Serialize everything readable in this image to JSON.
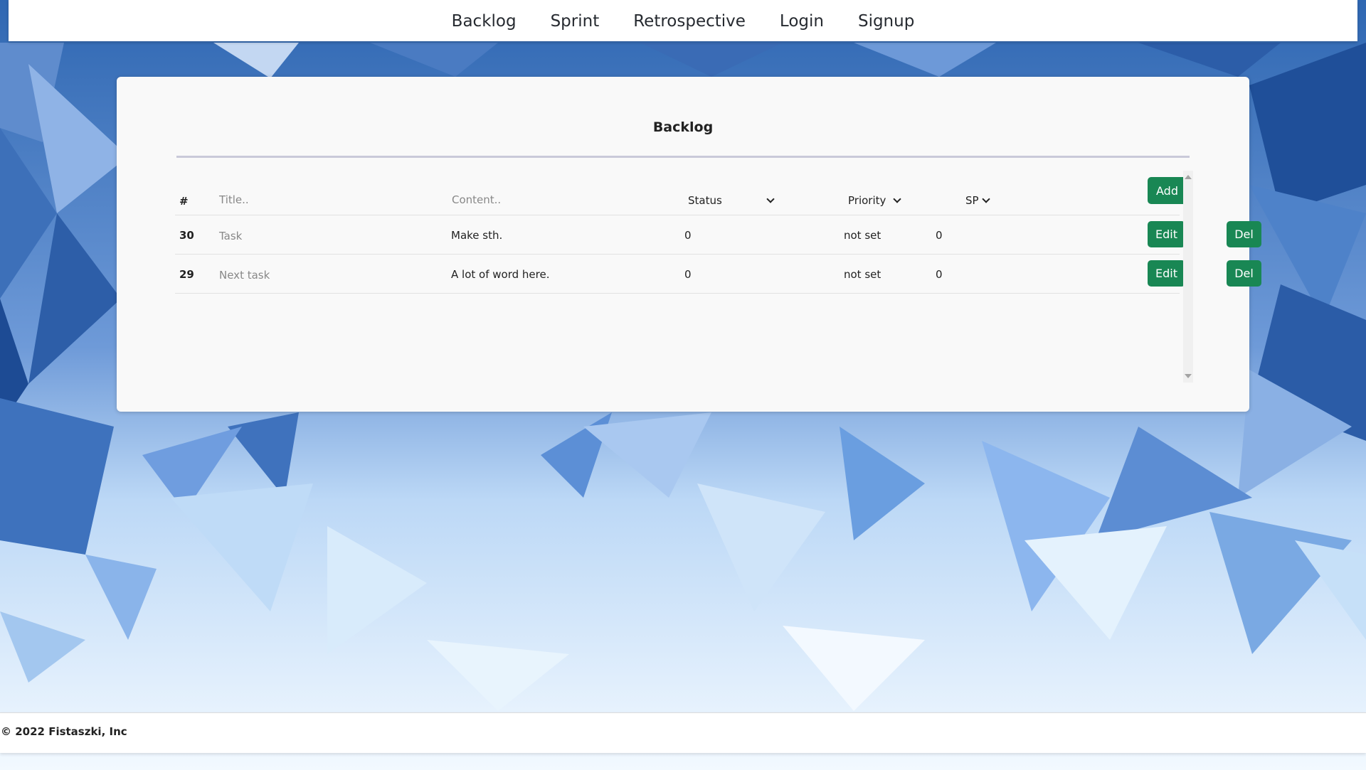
{
  "nav": {
    "links": [
      "Backlog",
      "Sprint",
      "Retrospective",
      "Login",
      "Signup"
    ]
  },
  "backlog": {
    "title": "Backlog",
    "header": {
      "id_label": "#",
      "title_placeholder": "Title..",
      "content_placeholder": "Content..",
      "status_label": "Status",
      "priority_label": "Priority",
      "sp_label": "SP",
      "add_label": "Add"
    },
    "rows": [
      {
        "id": "30",
        "title": "Task",
        "content": "Make sth.",
        "status": "0",
        "priority": "not set",
        "sp": "0",
        "edit": "Edit",
        "del": "Del"
      },
      {
        "id": "29",
        "title": "Next task",
        "content": "A lot of word here.",
        "status": "0",
        "priority": "not set",
        "sp": "0",
        "edit": "Edit",
        "del": "Del"
      }
    ]
  },
  "footer": {
    "text": "© 2022 Fistaszki, Inc"
  },
  "colors": {
    "button": "#198754",
    "background_blue": "#2f69b3",
    "card": "#f9f9f9"
  }
}
